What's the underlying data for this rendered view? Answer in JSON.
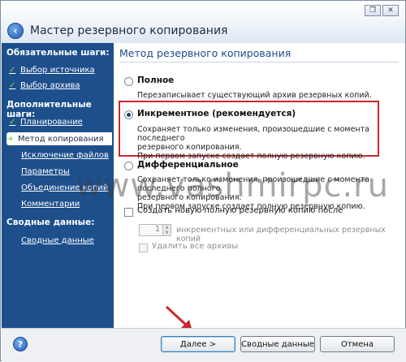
{
  "window": {
    "title": "Мастер резервного копирования"
  },
  "sidebar": {
    "required_heading": "Обязательные шаги:",
    "required_items": [
      {
        "label": "Выбор источника",
        "done": true
      },
      {
        "label": "Выбор архива",
        "done": true
      }
    ],
    "additional_heading": "Дополнительные шаги:",
    "additional_items": [
      {
        "label": "Планирование",
        "done": true
      },
      {
        "label": "Метод копирования",
        "active": true
      },
      {
        "label": "Исключение файлов"
      },
      {
        "label": "Параметры"
      },
      {
        "label": "Объединение копий"
      },
      {
        "label": "Комментарии"
      }
    ],
    "summary_heading": "Сводные данные:",
    "summary_items": [
      {
        "label": "Сводные данные"
      }
    ]
  },
  "main": {
    "section_title": "Метод резервного копирования",
    "options": [
      {
        "label": "Полное",
        "selected": false,
        "desc": [
          "Перезаписывает существующий архив резервных копий."
        ]
      },
      {
        "label": "Инкрементное (рекомендуется)",
        "selected": true,
        "desc": [
          "Сохраняет только изменения, произошедшие с момента последнего",
          "резервного копирования.",
          "При первом запуске создает полную резервную копию."
        ]
      },
      {
        "label": "Дифференциальное",
        "selected": false,
        "desc": [
          "Сохраняет только изменения, произошедшие с момента последнего полного",
          "резервного копирования.",
          "При первом запуске создает полную резервную копию."
        ]
      }
    ],
    "create_full_checkbox": {
      "label": "Создать новую полную резервную копию после",
      "checked": false
    },
    "interval_value": "1",
    "interval_label": "инкрементных или дифференциальных резервных копий",
    "delete_archives_checkbox": {
      "label": "Удалить все архивы",
      "checked": false
    }
  },
  "footer": {
    "next_label": "Далее >",
    "summary_label": "Сводные данные",
    "cancel_label": "Отмена"
  },
  "watermark": "www.vashmirpc.ru",
  "colors": {
    "sidebar": "#1d4f8c",
    "highlight": "#c8272d",
    "check": "#7ed957"
  }
}
